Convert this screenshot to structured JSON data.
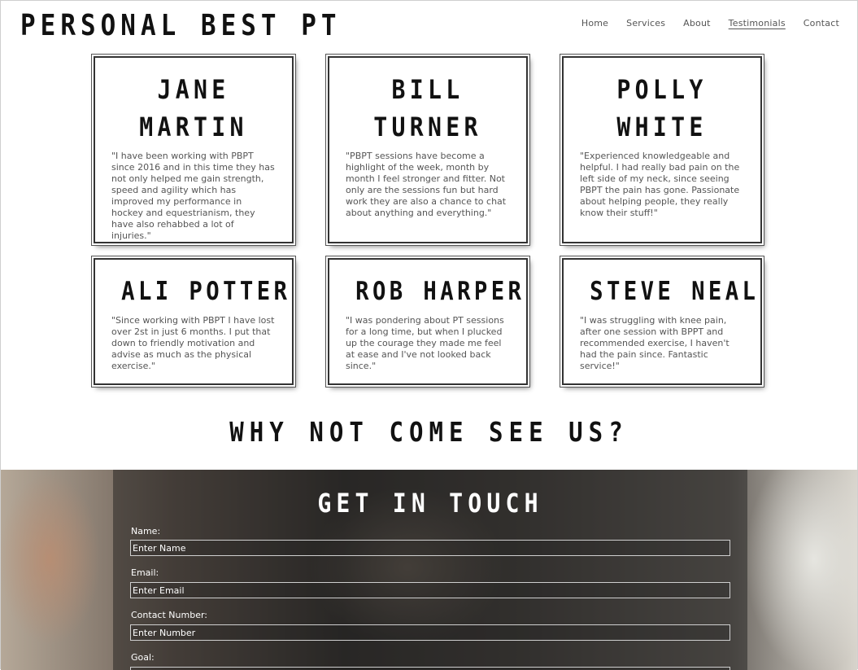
{
  "header": {
    "brand": "PERSONAL BEST PT",
    "nav": [
      "Home",
      "Services",
      "About",
      "Testimonials",
      "Contact"
    ]
  },
  "testimonials": [
    {
      "name": "JANE MARTIN",
      "text": "\"I have been working with PBPT since 2016 and in this time they has not only helped me gain strength, speed and agility which has improved my performance in hockey and equestrianism, they have also rehabbed a lot of injuries.\""
    },
    {
      "name": "BILL TURNER",
      "text": "\"PBPT sessions have become a highlight of the week, month by month I feel stronger and fitter. Not only are the sessions fun but hard work they are also a chance to chat about anything and everything.\""
    },
    {
      "name": "POLLY WHITE",
      "text": "\"Experienced knowledgeable and helpful. I had really bad pain on the left side of my neck, since seeing PBPT the pain has gone. Passionate about helping people, they really know their stuff!\""
    },
    {
      "name": "ALI POTTER",
      "text": "\"Since working with PBPT I have lost over 2st in just 6 months. I put that down to friendly motivation and advise as much as the physical exercise.\""
    },
    {
      "name": "ROB HARPER",
      "text": "\"I was pondering about PT sessions for a long time, but when I plucked up the courage they made me feel at ease and I've not looked back since.\""
    },
    {
      "name": "STEVE NEAL",
      "text": "\"I was struggling with knee pain, after one session with BPPT and recommended exercise, I haven't had the pain since. Fantastic service!\""
    }
  ],
  "why_heading": "WHY NOT COME SEE US?",
  "contact": {
    "title": "GET IN TOUCH",
    "fields": [
      {
        "label": "Name:",
        "placeholder": "Enter Name"
      },
      {
        "label": "Email:",
        "placeholder": "Enter Email"
      },
      {
        "label": "Contact Number:",
        "placeholder": "Enter Number"
      },
      {
        "label": "Goal:",
        "placeholder": ""
      }
    ]
  }
}
